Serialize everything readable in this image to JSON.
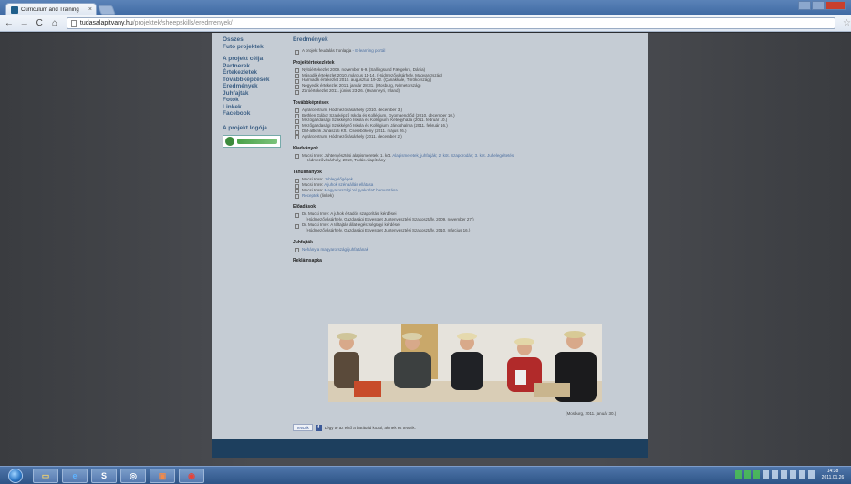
{
  "browser": {
    "tab_title": "Curriculum and Training",
    "tab_close": "×",
    "url_domain": "tudasalapitvany.hu",
    "url_path": "/projektek/sheepskills/eredmenyek/",
    "back": "←",
    "forward": "→",
    "reload": "C",
    "home": "⌂",
    "star": "☆"
  },
  "sidebar": {
    "items_top": [
      "Összes",
      "Futó projektek"
    ],
    "items_main": [
      "A projekt célja",
      "Partnerek",
      "Értekezletek",
      "Továbbképzések",
      "Eredmények",
      "Juhfajták",
      "Fotók",
      "Linkek",
      "Facebook"
    ],
    "logo_title": "A projekt logója"
  },
  "content": {
    "title": "Eredmények",
    "intro_item": "A projekt feudalás tronlapja",
    "intro_link": " - E-learning portál",
    "sections": [
      {
        "heading": "Projektértekezletek",
        "items": [
          "Nyitóértekezlet 2009. november 6-9. (Sallingsund Færgekro, Dánia)",
          "Második értekezlet 2010. március 11-14. (Hódmezővásárhely, Magyarország)",
          "Harmadik értekezlet 2010. augusztus 19-22. (Çanakkale, Törökország)",
          "Negyedik értekezlet 2011. január 28-31. (Mosburg, Németország)",
          "Záróértekezlet 2011. június 23-26. (Hvanneyri, Izland)"
        ]
      },
      {
        "heading": "Továbbképzések",
        "items": [
          "Agrárcentrum, Hódmezővásárhely (2010. december 3.)",
          "Bethlen Gábor Szakképző Iskola és Kollégium, Gyomaendrőd (2010. december 10.)",
          "Mezőgazdasági Szakképző Iskola és Kollégium, Kétegyháza (2011. február 10.)",
          "Mezőgazdasági Szakképző Iskola és Kollégium, Jánoshalma (2011. február 16.)",
          "DM-altkirik Juhászati Kft., Cserebökény (2011. május 26.)",
          "Agrárcentrum, Hódmezővásárhely (2011. december 2.)"
        ]
      }
    ],
    "publications": {
      "heading": "Kiadványok",
      "item_prefix": "Mucsi Imre: Juhtenyésztési alapismeretek, 1. köt. ",
      "item_links": "Alapismeretek_juhfajták; 2. köt. Szaporodás; 3. köt. Juhelegeltetés",
      "item_sub": "Hódmezővásárhely, 2010, Tudás Alapítvány"
    },
    "studies": {
      "heading": "Tanulmányok",
      "items": [
        {
          "prefix": "Mucsi Imre: ",
          "link": "Juhlegelőgépek"
        },
        {
          "prefix": "Mucsi Imre: ",
          "link": "A juhok szénaállás ellátása"
        },
        {
          "prefix": "Mucsi Imre: ",
          "link": "Magyarországi 'el gyakorlat' bemutatása"
        },
        {
          "prefix": "",
          "link": "Receptek",
          "suffix": " (linkek)"
        }
      ]
    },
    "lectures": {
      "heading": "Előadások",
      "items": [
        {
          "main": "Dr. Mucsi Imre: A juhok értadós szaporítási kérdései",
          "sub": "(Hódmezővásárhely, Gazdasági Egyesület Juhtenyésztési Szakosztály, 2009. november 27.)"
        },
        {
          "main": "Dr. Mucsi Imre: A téltajtás állat-egészségügyi kérdései",
          "sub": "(Hódmezővásárhely, Gazdasági Egyesület Juhtenyésztési Szakosztály, 2010. március 16.)"
        }
      ]
    },
    "breeds": {
      "heading": "Juhfajták",
      "item": "Néhány a magyarországi juhfajtának"
    },
    "ad_cap": {
      "heading": "Reklámsapka"
    },
    "photo_caption": "(Mosburg, 2011. január 30.)",
    "like_button": "Tetszik",
    "like_text": "Légy te az első a barátaid közül, akinek ez tetszik."
  },
  "taskbar": {
    "clock_time": "14:38",
    "clock_date": "2011.01.26"
  },
  "colors": {
    "page_bg": "#c5ccd4",
    "link": "#3c5f84",
    "footer": "#1d3f5e",
    "taskbar": "#3d6599"
  }
}
